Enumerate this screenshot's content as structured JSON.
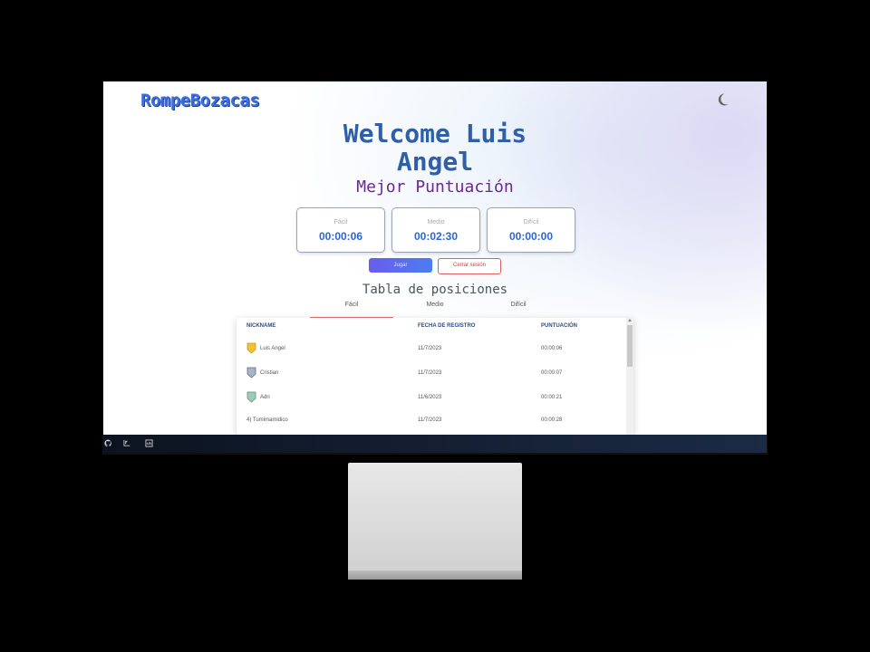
{
  "app": {
    "logo": "RompeBozacas"
  },
  "welcome": {
    "line1": "Welcome Luis",
    "line2": "Angel"
  },
  "best_score_title": "Mejor Puntuación",
  "scores": [
    {
      "label": "Fácil",
      "value": "00:00:06"
    },
    {
      "label": "Medio",
      "value": "00:02:30"
    },
    {
      "label": "Difícil",
      "value": "00:00:00"
    }
  ],
  "buttons": {
    "play": "Jugar",
    "logout": "Cerrar sesión"
  },
  "leaderboard": {
    "title": "Tabla de posiciones",
    "tabs": [
      "Fácil",
      "Medio",
      "Difícil"
    ],
    "active_tab": "Fácil",
    "columns": [
      "NICKNAME",
      "FECHA DE REGISTRO",
      "PUNTUACIÓN"
    ],
    "rows": [
      {
        "rank": "1)",
        "medal": "gold",
        "nickname": "Luis Angel",
        "date": "11/7/2023",
        "score": "00:00:06"
      },
      {
        "rank": "2)",
        "medal": "silver",
        "nickname": "Cristian",
        "date": "11/7/2023",
        "score": "00:00:07"
      },
      {
        "rank": "3)",
        "medal": "bronze",
        "nickname": "Adri",
        "date": "11/6/2023",
        "score": "00:00:21"
      },
      {
        "rank": "4)",
        "medal": "",
        "nickname": "4) Tumimamidico",
        "date": "11/7/2023",
        "score": "00:00:28"
      }
    ]
  },
  "footer": {
    "icons": [
      "github-icon",
      "linkedin-alt-icon",
      "linkedin-icon"
    ]
  },
  "colors": {
    "accent": "#2a66d6",
    "title": "#2e5fa8",
    "subtitle": "#6a2890",
    "logout": "#d04040"
  }
}
